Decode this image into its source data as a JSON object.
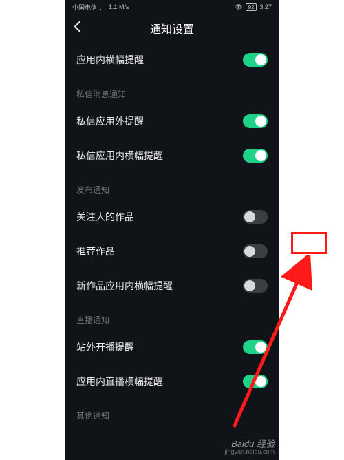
{
  "status": {
    "carrier": "中国电信",
    "wifi": "1.1 M/s",
    "battery": "92",
    "time": "3:27"
  },
  "header": {
    "title": "通知设置"
  },
  "rows": {
    "r0": {
      "label": "应用内横幅提醒",
      "on": true
    },
    "r1": {
      "label": "私信应用外提醒",
      "on": true
    },
    "r2": {
      "label": "私信应用内横幅提醒",
      "on": true
    },
    "r3": {
      "label": "关注人的作品",
      "on": false
    },
    "r4": {
      "label": "推荐作品",
      "on": false
    },
    "r5": {
      "label": "新作品应用内横幅提醒",
      "on": false
    },
    "r6": {
      "label": "站外开播提醒",
      "on": true
    },
    "r7": {
      "label": "应用内直播横幅提醒",
      "on": true
    }
  },
  "sections": {
    "s1": "私信消息通知",
    "s2": "发布通知",
    "s3": "直播通知",
    "s4": "其他通知"
  },
  "watermark": {
    "main": "Baidu 经验",
    "sub": "jingyan.baidu.com"
  },
  "annotation": {
    "highlight_color": "#ff1a1a"
  }
}
